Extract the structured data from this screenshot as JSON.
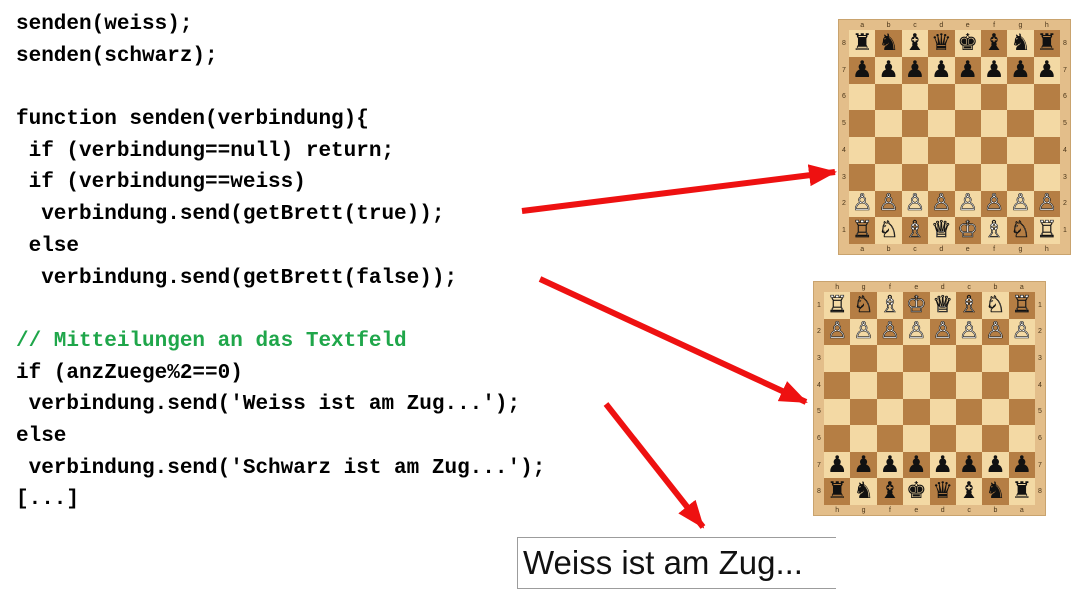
{
  "code_lines": [
    {
      "text": "senden(weiss);",
      "kind": "code"
    },
    {
      "text": "senden(schwarz);",
      "kind": "code"
    },
    {
      "text": "",
      "kind": "code"
    },
    {
      "text": "function senden(verbindung){",
      "kind": "code"
    },
    {
      "text": " if (verbindung==null) return;",
      "kind": "code"
    },
    {
      "text": " if (verbindung==weiss)",
      "kind": "code"
    },
    {
      "text": "  verbindung.send(getBrett(true));",
      "kind": "code"
    },
    {
      "text": " else",
      "kind": "code"
    },
    {
      "text": "  verbindung.send(getBrett(false));",
      "kind": "code"
    },
    {
      "text": "",
      "kind": "code"
    },
    {
      "text": "// Mitteilungen an das Textfeld",
      "kind": "comment"
    },
    {
      "text": "if (anzZuege%2==0)",
      "kind": "code"
    },
    {
      "text": " verbindung.send('Weiss ist am Zug...');",
      "kind": "code"
    },
    {
      "text": "else",
      "kind": "code"
    },
    {
      "text": " verbindung.send('Schwarz ist am Zug...');",
      "kind": "code"
    },
    {
      "text": "[...]",
      "kind": "code"
    }
  ],
  "colors": {
    "comment": "#1fa64a",
    "arrow": "#ee1111",
    "light_square": "#f3d9a4",
    "dark_square": "#b57e44"
  },
  "boards": [
    {
      "id": "white-view",
      "files": [
        "a",
        "b",
        "c",
        "d",
        "e",
        "f",
        "g",
        "h"
      ],
      "ranks": [
        "8",
        "7",
        "6",
        "5",
        "4",
        "3",
        "2",
        "1"
      ],
      "rows": [
        [
          "♜",
          "♞",
          "♝",
          "♛",
          "♚",
          "♝",
          "♞",
          "♜"
        ],
        [
          "♟",
          "♟",
          "♟",
          "♟",
          "♟",
          "♟",
          "♟",
          "♟"
        ],
        [
          "",
          "",
          "",
          "",
          "",
          "",
          "",
          ""
        ],
        [
          "",
          "",
          "",
          "",
          "",
          "",
          "",
          ""
        ],
        [
          "",
          "",
          "",
          "",
          "",
          "",
          "",
          ""
        ],
        [
          "",
          "",
          "",
          "",
          "",
          "",
          "",
          ""
        ],
        [
          "♙",
          "♙",
          "♙",
          "♙",
          "♙",
          "♙",
          "♙",
          "♙"
        ],
        [
          "♖",
          "♘",
          "♗",
          "♕",
          "♔",
          "♗",
          "♘",
          "♖"
        ]
      ]
    },
    {
      "id": "black-view",
      "files": [
        "h",
        "g",
        "f",
        "e",
        "d",
        "c",
        "b",
        "a"
      ],
      "ranks": [
        "1",
        "2",
        "3",
        "4",
        "5",
        "6",
        "7",
        "8"
      ],
      "rows": [
        [
          "♖",
          "♘",
          "♗",
          "♔",
          "♕",
          "♗",
          "♘",
          "♖"
        ],
        [
          "♙",
          "♙",
          "♙",
          "♙",
          "♙",
          "♙",
          "♙",
          "♙"
        ],
        [
          "",
          "",
          "",
          "",
          "",
          "",
          "",
          ""
        ],
        [
          "",
          "",
          "",
          "",
          "",
          "",
          "",
          ""
        ],
        [
          "",
          "",
          "",
          "",
          "",
          "",
          "",
          ""
        ],
        [
          "",
          "",
          "",
          "",
          "",
          "",
          "",
          ""
        ],
        [
          "♟",
          "♟",
          "♟",
          "♟",
          "♟",
          "♟",
          "♟",
          "♟"
        ],
        [
          "♜",
          "♞",
          "♝",
          "♚",
          "♛",
          "♝",
          "♞",
          "♜"
        ]
      ]
    }
  ],
  "textfield": {
    "value": "Weiss ist am Zug..."
  }
}
